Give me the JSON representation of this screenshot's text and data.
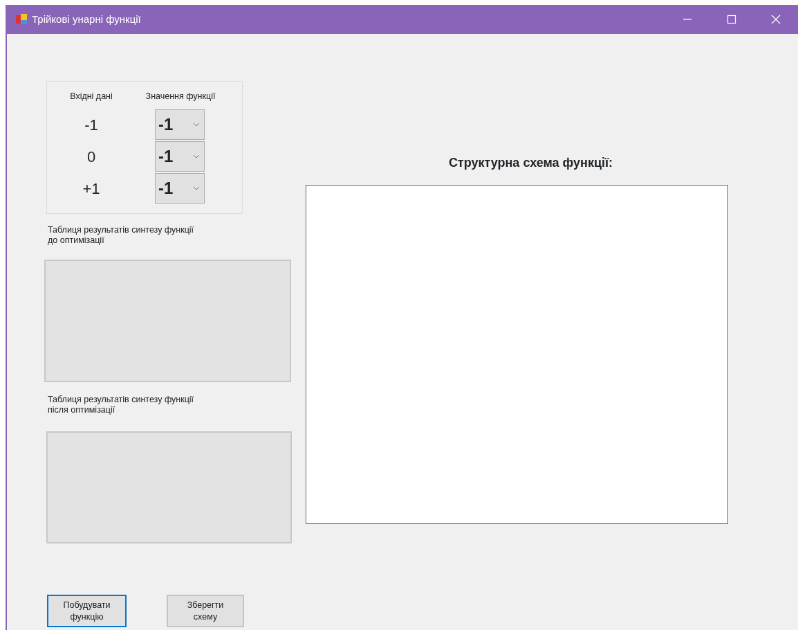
{
  "window": {
    "title": "Трійкові унарні функції"
  },
  "input_panel": {
    "headers": [
      "Вхідні дані",
      "Значення функції"
    ],
    "rows": [
      {
        "input": "-1",
        "value": "-1"
      },
      {
        "input": "0",
        "value": "-1"
      },
      {
        "input": "+1",
        "value": "-1"
      }
    ]
  },
  "tables": [
    {
      "label": "Таблиця результатів синтезу функції\nдо оптимізації"
    },
    {
      "label": "Таблиця результатів синтезу функції\nпісля оптимізації"
    }
  ],
  "schema": {
    "title": "Структурна схема функції:"
  },
  "buttons": [
    {
      "label": "Побудувати\nфункцію",
      "focused": true
    },
    {
      "label": "Зберегти\nсхему",
      "focused": false
    }
  ]
}
